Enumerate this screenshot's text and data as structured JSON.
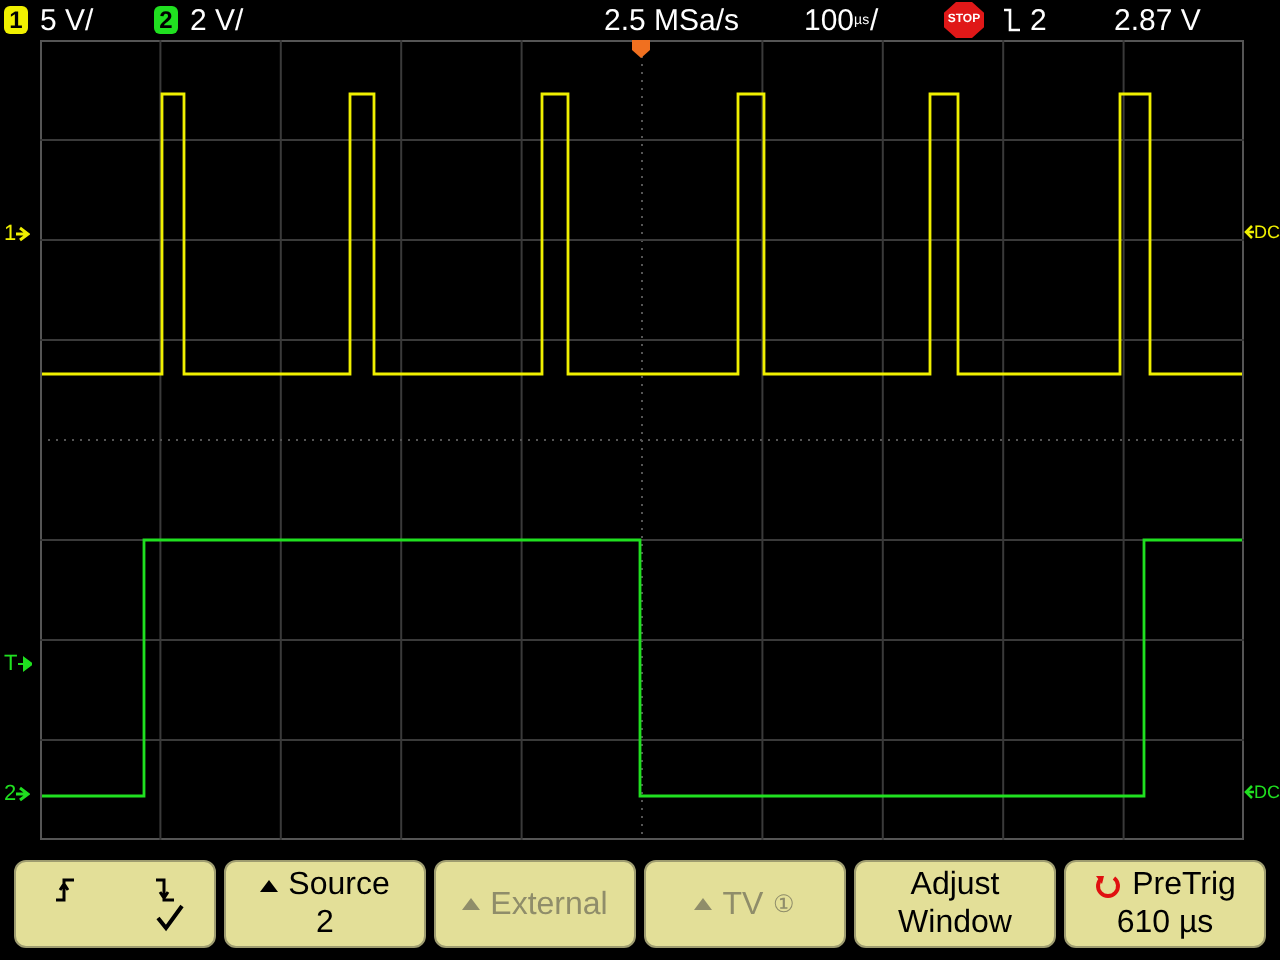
{
  "top_bar": {
    "channels": [
      {
        "number": "1",
        "scale": "5 V/",
        "color": "#f0f000"
      },
      {
        "number": "2",
        "scale": "2 V/",
        "color": "#20e020"
      }
    ],
    "sample_rate": "2.5 MSa/s",
    "timebase": {
      "value": "100",
      "unit_top": "µs",
      "unit_slash": "/"
    },
    "run_state": "STOP",
    "trigger": {
      "source": "2",
      "level": "2.87 V"
    }
  },
  "markers": {
    "left": [
      {
        "label": "1",
        "kind": "channel",
        "color": "#f0f000"
      },
      {
        "label": "T",
        "kind": "trigger",
        "color": "#20e020"
      },
      {
        "label": "2",
        "kind": "channel",
        "color": "#20e020"
      }
    ],
    "right": [
      {
        "label": "DC",
        "color": "#f0f000"
      },
      {
        "label": "DC",
        "color": "#20e020"
      }
    ]
  },
  "softkeys": [
    {
      "kind": "slope",
      "slopes": [
        {
          "kind": "rising",
          "selected": false
        },
        {
          "kind": "falling",
          "selected": true
        }
      ]
    },
    {
      "kind": "menu",
      "label": "Source",
      "value": "2",
      "disabled": false
    },
    {
      "kind": "menu",
      "label": "External",
      "disabled": true
    },
    {
      "kind": "menu",
      "label": "TV",
      "badge": "①",
      "disabled": true
    },
    {
      "kind": "plain",
      "label": "Adjust",
      "value": "Window"
    },
    {
      "kind": "knob",
      "label": "PreTrig",
      "value": "610 µs"
    }
  ]
}
